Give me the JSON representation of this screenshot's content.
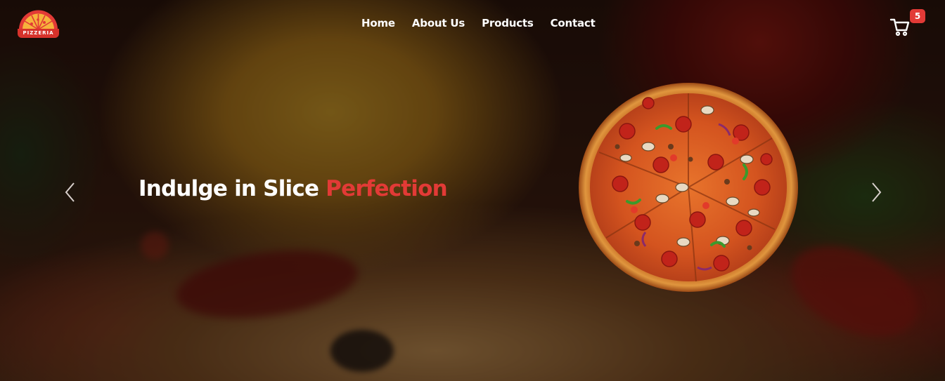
{
  "brand": {
    "logo_text": "PIZZERIA"
  },
  "nav": {
    "items": [
      {
        "label": "Home"
      },
      {
        "label": "About Us"
      },
      {
        "label": "Products"
      },
      {
        "label": "Contact"
      }
    ]
  },
  "cart": {
    "icon": "cart-icon",
    "count": "5"
  },
  "hero": {
    "headline_white": "Indulge in Slice",
    "headline_red": "Perfection",
    "prev_icon": "chevron-left-icon",
    "next_icon": "chevron-right-icon",
    "image": "pizza-image"
  },
  "colors": {
    "accent": "#e23a36",
    "text": "#ffffff"
  }
}
